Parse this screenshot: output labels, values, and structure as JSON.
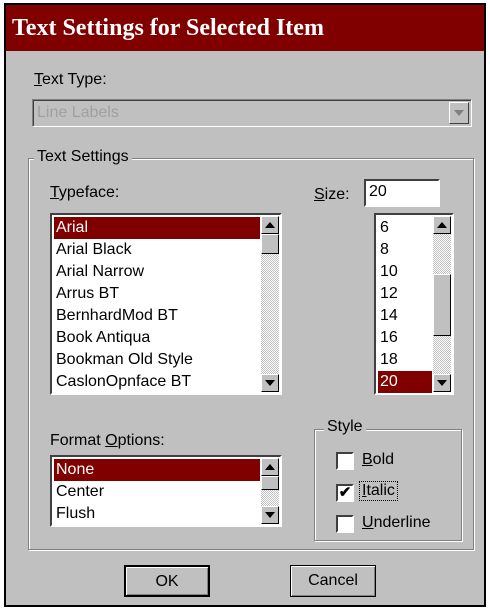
{
  "window": {
    "title": "Text Settings for Selected Item"
  },
  "text_type": {
    "label_prefix": "T",
    "label_rest": "ext Type:",
    "value": "Line Labels"
  },
  "text_settings": {
    "group_label": "Text Settings",
    "typeface": {
      "label_prefix": "T",
      "label_rest": "ypeface:",
      "items": [
        "Arial",
        "Arial Black",
        "Arial Narrow",
        "Arrus BT",
        "BernhardMod BT",
        "Book Antiqua",
        "Bookman Old Style",
        "CaslonOpnface BT"
      ],
      "selected": "Arial"
    },
    "size": {
      "label_prefix": "S",
      "label_rest": "ize:",
      "value": "20",
      "items": [
        "6",
        "8",
        "10",
        "12",
        "14",
        "16",
        "18",
        "20"
      ],
      "selected": "20"
    },
    "format_options": {
      "label_pre": "Format ",
      "label_u": "O",
      "label_rest": "ptions:",
      "items": [
        "None",
        "Center",
        "Flush"
      ],
      "selected": "None"
    },
    "style": {
      "group_label": "Style",
      "bold": {
        "label_u": "B",
        "label_rest": "old",
        "checked": false
      },
      "italic": {
        "label_u": "I",
        "label_rest": "talic",
        "checked": true
      },
      "underline": {
        "label_u": "U",
        "label_rest": "nderline",
        "checked": false
      }
    }
  },
  "buttons": {
    "ok": "OK",
    "cancel": "Cancel"
  },
  "colors": {
    "title_bar": "#800000",
    "selection": "#800000",
    "face": "#c0c0c0"
  },
  "icons": {
    "checkmark": "✔"
  }
}
